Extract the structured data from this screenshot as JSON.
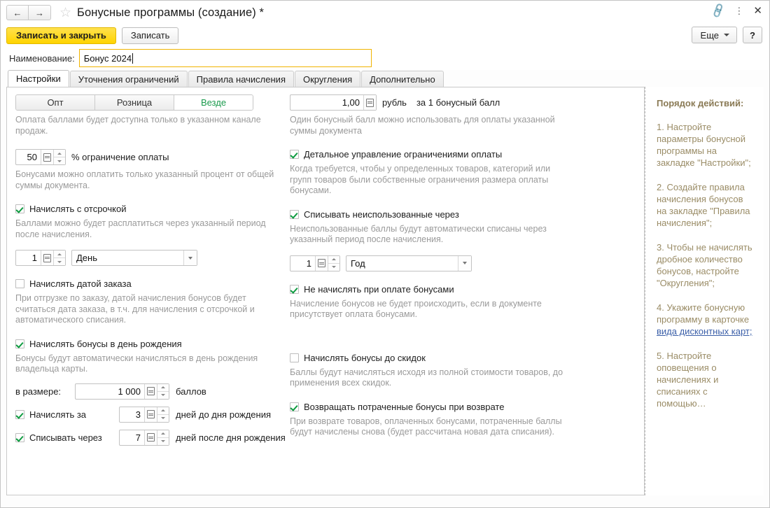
{
  "titlebar": {
    "back_icon": "arrow-left-icon",
    "forward_icon": "arrow-right-icon",
    "favorite_icon": "star-icon",
    "title": "Бонусные программы (создание) *",
    "link_icon": "link-icon",
    "menu_icon": "kebab-menu-icon",
    "close_icon": "close-icon"
  },
  "toolbar": {
    "save_and_close_label": "Записать и закрыть",
    "save_label": "Записать",
    "more_label": "Еще",
    "help_label": "?"
  },
  "name_row": {
    "label": "Наименование:",
    "value": "Бонус 2024"
  },
  "tabs": [
    {
      "label": "Настройки",
      "active": true
    },
    {
      "label": "Уточнения ограничений",
      "active": false
    },
    {
      "label": "Правила начисления",
      "active": false
    },
    {
      "label": "Округления",
      "active": false
    },
    {
      "label": "Дополнительно",
      "active": false
    }
  ],
  "left_column": {
    "channel_segmented": {
      "options": [
        "Опт",
        "Розница",
        "Везде"
      ],
      "selected": "Везде"
    },
    "channel_hint": "Оплата баллами будет доступна только в указанном канале продаж.",
    "payment_limit": {
      "value": "50",
      "unit": "% ограничение оплаты",
      "hint": "Бонусами можно оплатить только указанный процент от общей суммы документа."
    },
    "deferred": {
      "checked": true,
      "label": "Начислять с отсрочкой",
      "hint": "Баллами можно будет расплатиться через указанный период после начисления.",
      "period_value": "1",
      "period_unit": "День"
    },
    "order_date": {
      "checked": false,
      "label": "Начислять датой заказа",
      "hint": "При отгрузке по заказу, датой начисления бонусов будет считаться дата заказа, в т.ч. для начисления с отсрочкой и автоматического списания."
    },
    "birthday": {
      "checked": true,
      "label": "Начислять бонусы в день рождения",
      "hint": "Бонусы будут автоматически начисляться в день рождения владельца карты.",
      "amount_label": "в размере:",
      "amount_value": "1 000",
      "amount_unit": "баллов",
      "accrue_before_checked": true,
      "accrue_before_label": "Начислять за",
      "accrue_before_value": "3",
      "accrue_before_unit": "дней до дня рождения",
      "writeoff_after_checked": true,
      "writeoff_after_label": "Списывать через",
      "writeoff_after_value": "7",
      "writeoff_after_unit": "дней после дня рождения"
    }
  },
  "right_column": {
    "rate": {
      "value": "1,00",
      "currency": "рубль",
      "per": "за 1 бонусный балл",
      "hint": "Один бонусный балл можно использовать для оплаты указанной суммы документа"
    },
    "detailed_limits": {
      "checked": true,
      "label": "Детальное управление ограничениями оплаты",
      "hint": "Когда требуется, чтобы у определенных товаров, категорий или групп товаров были собственные ограничения размера оплаты бонусами."
    },
    "writeoff_unused": {
      "checked": true,
      "label": "Списывать неиспользованные через",
      "hint": "Неиспользованные баллы будут автоматически списаны через указанный период после начисления.",
      "period_value": "1",
      "period_unit": "Год"
    },
    "no_accrual_on_bonus_payment": {
      "checked": true,
      "label": "Не начислять при оплате бонусами",
      "hint": "Начисление бонусов не будет происходить, если в документе присутствует оплата бонусами."
    },
    "accrue_before_discounts": {
      "checked": false,
      "label": "Начислять бонусы до скидок",
      "hint": "Баллы будут начисляться исходя из полной стоимости товаров, до применения всех скидок."
    },
    "return_spent_bonuses": {
      "checked": true,
      "label": "Возвращать потраченные бонусы при возврате",
      "hint": "При возврате товаров, оплаченных бонусами, потраченные баллы будут начислены снова (будет рассчитана новая дата списания)."
    }
  },
  "sidebar": {
    "title": "Порядок действий:",
    "steps": [
      {
        "text": "1. Настройте параметры бонусной программы на закладке \"Настройки\";"
      },
      {
        "text": "2. Создайте правила начисления бонусов на закладке \"Правила начисления\";"
      },
      {
        "text": "3. Чтобы не начислять дробное количество бонусов, настройте \"Округления\";"
      },
      {
        "text_before": "4. Укажите бонусную программу в карточке ",
        "link": "вида дисконтных карт;"
      },
      {
        "text": "5. Настройте оповещения о начислениях и списаниях с помощью…"
      }
    ]
  },
  "colors": {
    "accent_yellow": "#ffd400",
    "check_green": "#0d9b3f",
    "selected_green": "#1a9a4c",
    "link_blue": "#3b5fa8",
    "hint_gray": "#9a9a9a",
    "sidebar_text": "#9a8c66"
  }
}
